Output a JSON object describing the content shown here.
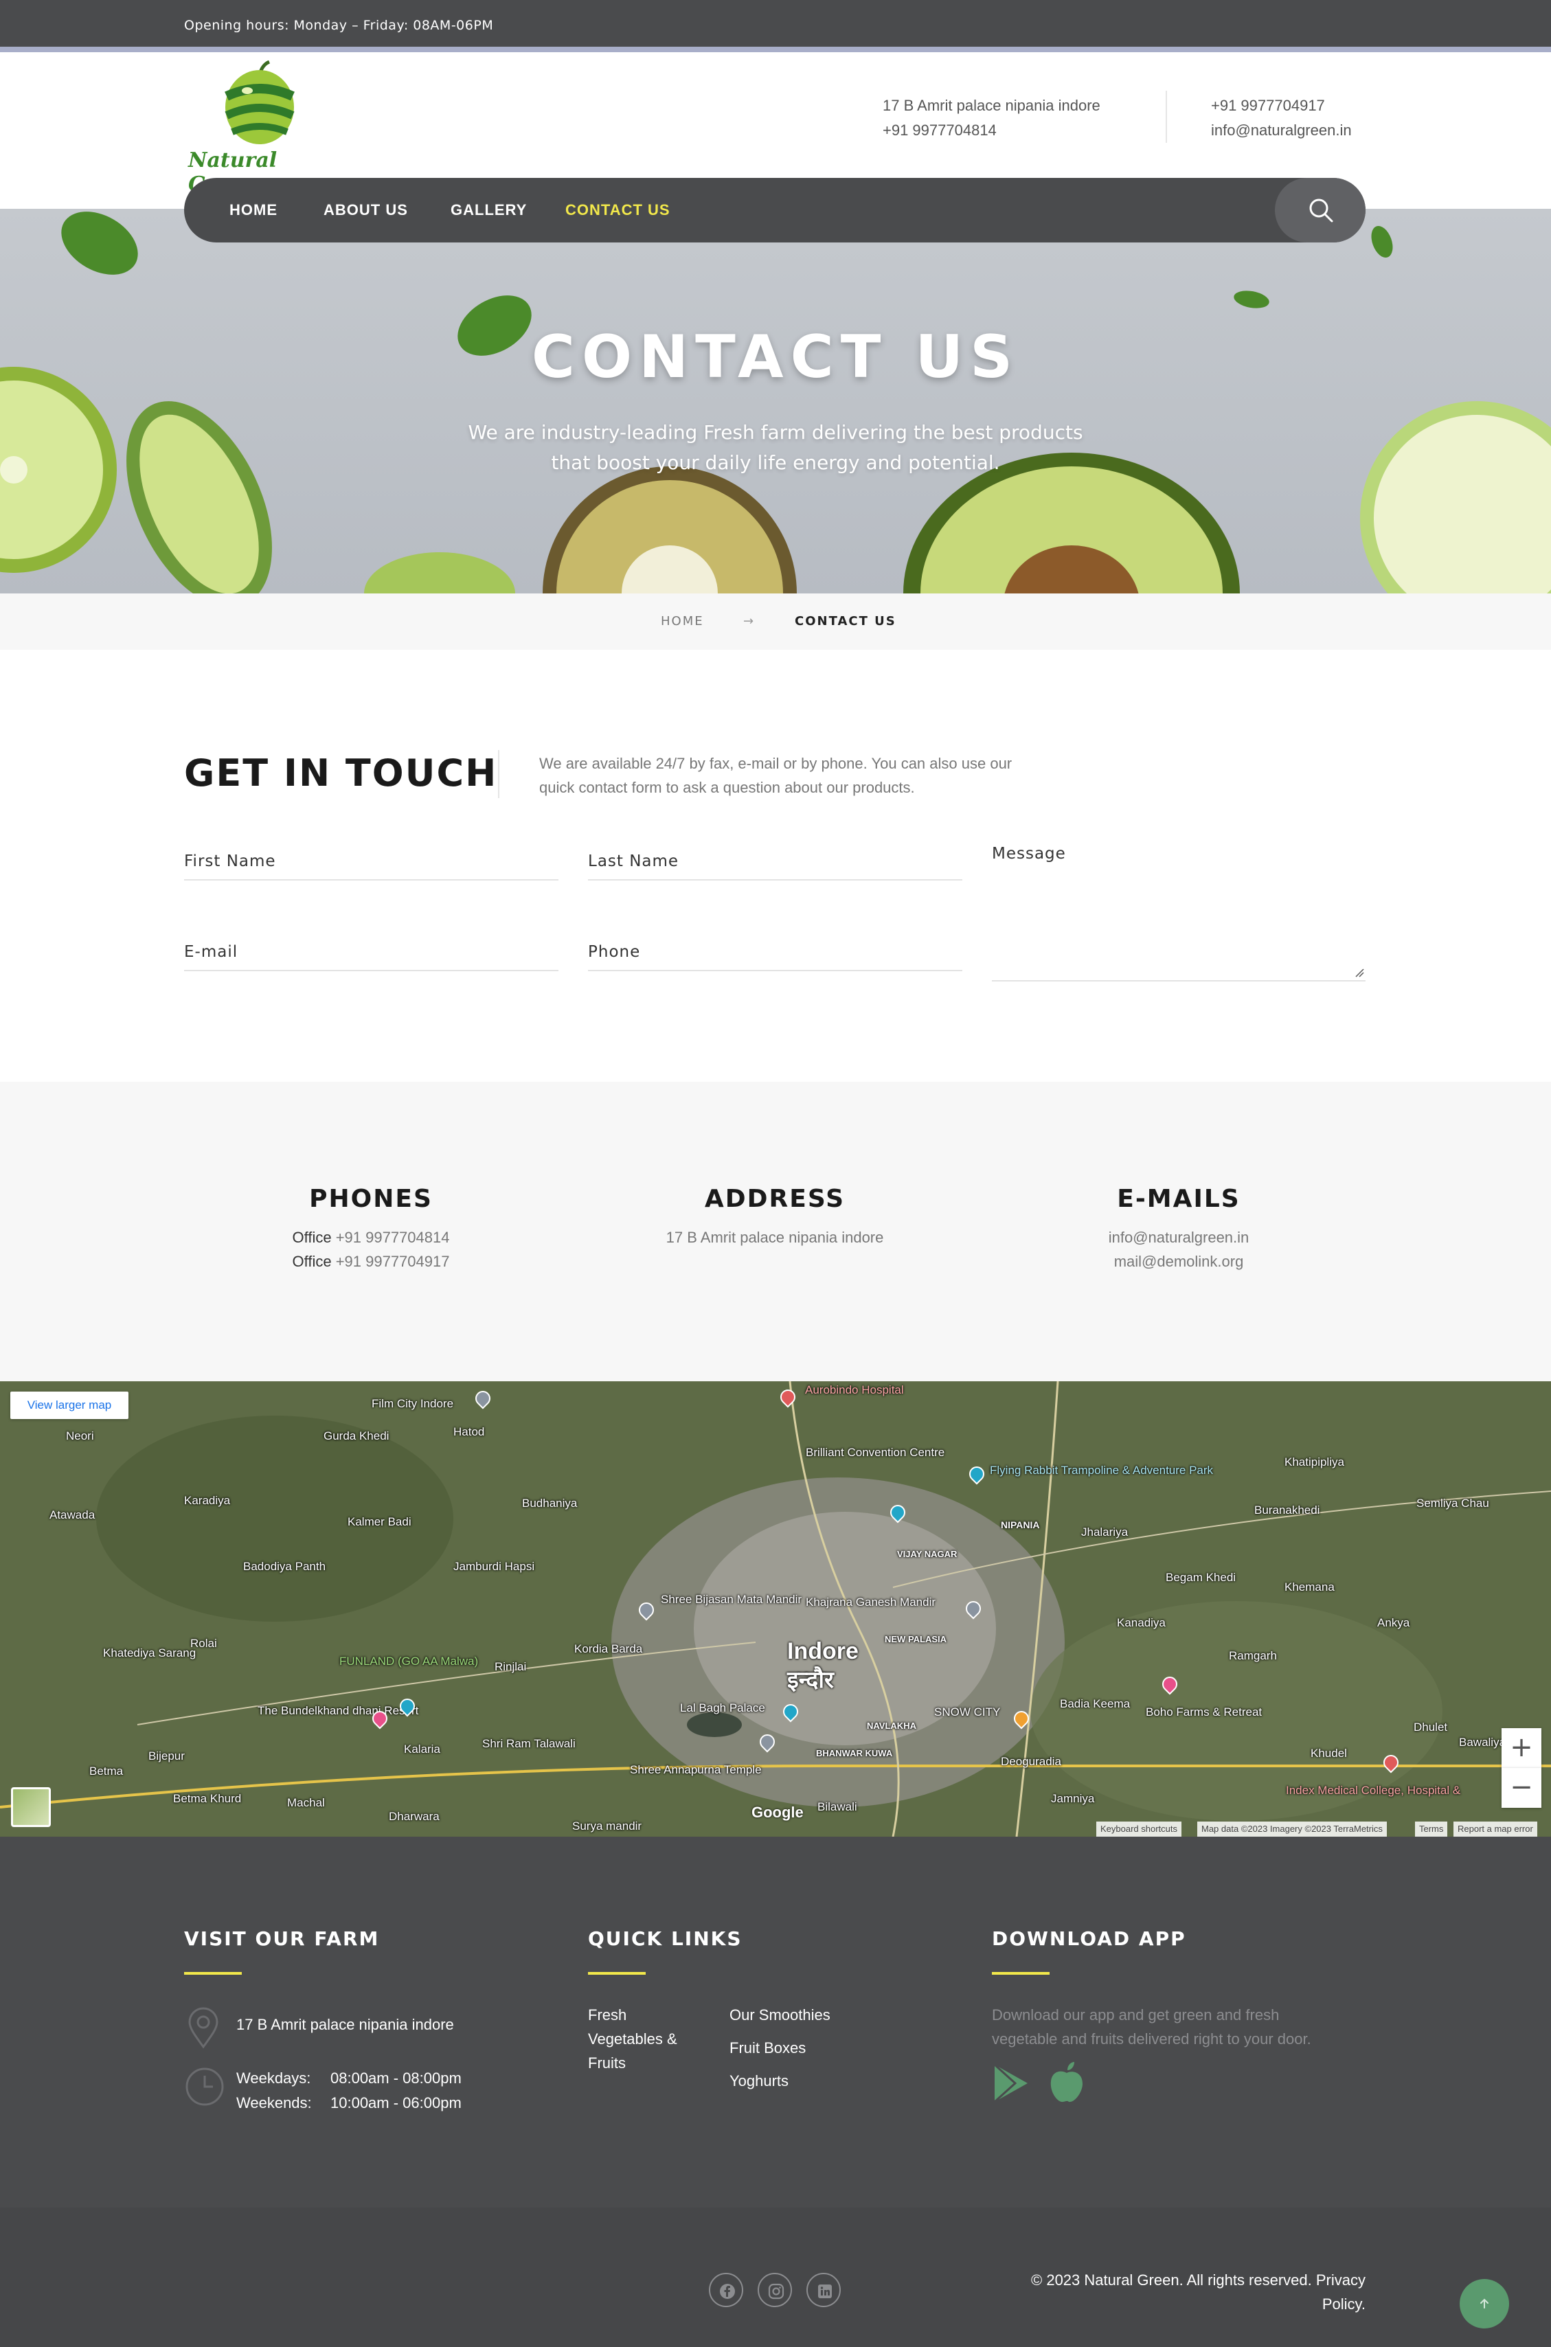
{
  "topbar": {
    "hours": "Opening hours: Monday – Friday: 08AM-06PM"
  },
  "header": {
    "logo_text": "Natural Green",
    "address": "17 B Amrit palace nipania indore",
    "phone1": "+91 9977704814",
    "phone2": "+91 9977704917",
    "email": "info@naturalgreen.in"
  },
  "nav": {
    "items": [
      {
        "label": "HOME"
      },
      {
        "label": "ABOUT US"
      },
      {
        "label": "GALLERY"
      },
      {
        "label": "CONTACT US",
        "active": true
      }
    ]
  },
  "hero": {
    "title": "CONTACT US",
    "subtitle_line1": "We are industry-leading Fresh farm delivering the best products",
    "subtitle_line2": "that boost your daily life energy and potential."
  },
  "breadcrumb": {
    "home": "HOME",
    "separator": "→",
    "current": "CONTACT US"
  },
  "get_in_touch": {
    "title": "GET IN TOUCH",
    "text_line1": "We are available 24/7 by fax, e-mail or by phone. You can also use our",
    "text_line2": "quick contact form to ask a question about our products."
  },
  "form": {
    "first_name_placeholder": "First Name",
    "last_name_placeholder": "Last Name",
    "message_placeholder": "Message",
    "email_placeholder": "E-mail",
    "phone_placeholder": "Phone"
  },
  "info": {
    "phones": {
      "title": "PHONES",
      "office_label": "Office",
      "number1": "+91 9977704814",
      "number2": "+91 9977704917"
    },
    "address": {
      "title": "ADDRESS",
      "line": "17 B Amrit palace nipania indore"
    },
    "emails": {
      "title": "E-MAILS",
      "email1": "info@naturalgreen.in",
      "email2": "mail@demolink.org"
    }
  },
  "map": {
    "view_larger": "View larger map",
    "city_en": "Indore",
    "city_hi": "इन्दौर",
    "labels": {
      "film_city": "Film City Indore",
      "aurobindo": "Aurobindo Hospital",
      "neori": "Neori",
      "gurda_khedi": "Gurda Khedi",
      "hatod": "Hatod",
      "brilliant": "Brilliant Convention Centre",
      "flying_rabbit": "Flying Rabbit Trampoline & Adventure Park",
      "khatipipliya": "Khatipipliya",
      "atawada": "Atawada",
      "karadiya": "Karadiya",
      "kalmer_badi": "Kalmer Badi",
      "budhaniya": "Budhaniya",
      "buranakhedi": "Buranakhedi",
      "semliya_chau": "Semliya Chau",
      "nipania": "NIPANIA",
      "vijay_nagar": "VIJAY NAGAR",
      "jhalariya": "Jhalariya",
      "badodiya_panth": "Badodiya Panth",
      "jamburdi_hapsi": "Jamburdi Hapsi",
      "begam_khedi": "Begam Khedi",
      "khemana": "Khemana",
      "shree_bijasan": "Shree Bijasan Mata Mandir",
      "khajrana": "Khajrana Ganesh Mandir",
      "kanadiya": "Kanadiya",
      "ankya": "Ankya",
      "rolai": "Rolai",
      "khatediya_sarang": "Khatediya Sarang",
      "funland": "FUNLAND (GO AA Malwa)",
      "kordia_barda": "Kordia Barda",
      "rinjlai": "Rinjlai",
      "new_palasia": "NEW PALASIA",
      "ramgarh": "Ramgarh",
      "bundelkhand": "The Bundelkhand dhani Resort",
      "lal_bagh": "Lal Bagh Palace",
      "snow_city": "SNOW CITY",
      "badia_keema": "Badia Keema",
      "boho_farms": "Boho Farms & Retreat",
      "navlakha": "NAVLAKHA",
      "dhulet": "Dhulet",
      "bawaliya": "Bawaliya Khurd",
      "kalaria": "Kalaria",
      "shri_ram_talawali": "Shri Ram Talawali",
      "bijepur": "Bijepur",
      "betma": "Betma",
      "shree_annapurna": "Shree Annapurna Temple",
      "bhanwar_kuwa": "BHANWAR KUWA",
      "deoguradia": "Deoguradia",
      "khudel": "Khudel",
      "index_medical": "Index Medical College, Hospital &",
      "betma_khurd": "Betma Khurd",
      "machal": "Machal",
      "dharwara": "Dharwara",
      "jamniya": "Jamniya",
      "bilawali": "Bilawali",
      "surya_mandir": "Surya mandir"
    },
    "zoom_in": "+",
    "zoom_out": "−",
    "google": "Google",
    "attrib_shortcuts": "Keyboard shortcuts",
    "attrib_data": "Map data ©2023 Imagery ©2023 TerraMetrics",
    "attrib_terms": "Terms",
    "attrib_report": "Report a map error"
  },
  "footer": {
    "visit": {
      "title": "VISIT OUR FARM",
      "address": "17 B Amrit palace nipania indore",
      "weekdays_label": "Weekdays:",
      "weekdays_hours": "08:00am - 08:00pm",
      "weekends_label": "Weekends:",
      "weekends_hours": "10:00am - 06:00pm"
    },
    "quick_links": {
      "title": "QUICK LINKS",
      "link1_line1": "Fresh",
      "link1_line2": "Vegetables &",
      "link1_line3": "Fruits",
      "link2": "Our Smoothies",
      "link3": "Fruit Boxes",
      "link4": "Yoghurts"
    },
    "app": {
      "title": "DOWNLOAD APP",
      "text_line1": "Download our app and get green and fresh",
      "text_line2": "vegetable and fruits delivered right to your door."
    }
  },
  "bottombar": {
    "copyright_line1": "©  2023 Natural Green.  All rights reserved. Privacy",
    "copyright_line2": "Policy."
  },
  "colors": {
    "dark": "#4a4b4d",
    "accent_yellow": "#f2e84b",
    "brand_green": "#3b8a2a",
    "app_icon_green": "#5a9a6e"
  },
  "icons": [
    "search-icon",
    "arrow-right-icon",
    "map-pin-icon",
    "clock-icon",
    "google-play-icon",
    "apple-icon",
    "facebook-icon",
    "instagram-icon",
    "linkedin-icon",
    "arrow-up-icon"
  ]
}
